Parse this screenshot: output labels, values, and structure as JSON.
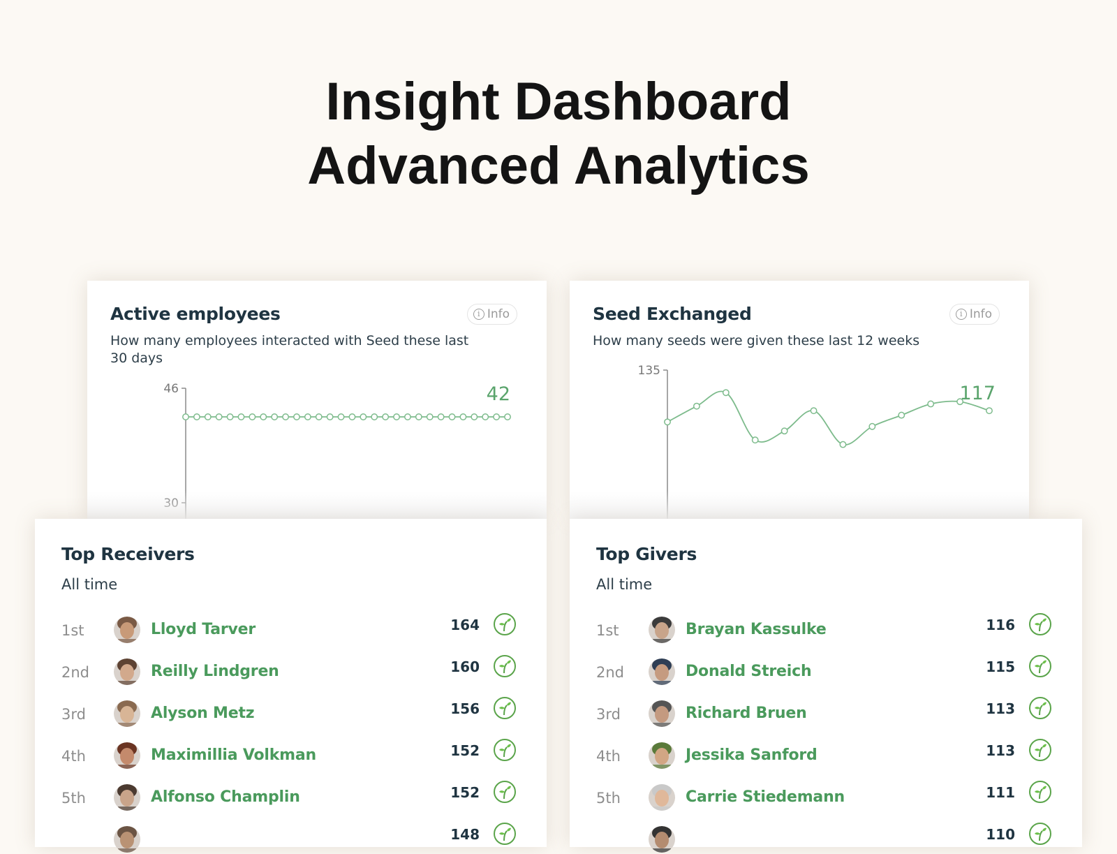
{
  "page": {
    "title_line1": "Insight Dashboard",
    "title_line2": "Advanced Analytics"
  },
  "colors": {
    "accent_green": "#4a9a5c",
    "line_green": "#7dbb8c",
    "title_dark": "#1f3441",
    "background": "#fcf9f4"
  },
  "cards": {
    "active_employees": {
      "title": "Active employees",
      "subtitle_line1": "How many employees interacted with Seed these last",
      "subtitle_line2": "30 days",
      "info_label": "Info",
      "info_icon": "info-circle-icon"
    },
    "seed_exchanged": {
      "title": "Seed Exchanged",
      "subtitle": "How many seeds were given these last 12 weeks",
      "info_label": "Info",
      "info_icon": "info-circle-icon"
    },
    "top_receivers": {
      "title": "Top Receivers",
      "subtitle": "All time",
      "rows": [
        {
          "rank": "1st",
          "name": "Lloyd Tarver",
          "count": "164"
        },
        {
          "rank": "2nd",
          "name": "Reilly Lindgren",
          "count": "160"
        },
        {
          "rank": "3rd",
          "name": "Alyson Metz",
          "count": "156"
        },
        {
          "rank": "4th",
          "name": "Maximillia Volkman",
          "count": "152"
        },
        {
          "rank": "5th",
          "name": "Alfonso Champlin",
          "count": "152"
        },
        {
          "rank": "",
          "name": "",
          "count": "148"
        }
      ],
      "row_icon": "seed-sprout-icon"
    },
    "top_givers": {
      "title": "Top Givers",
      "subtitle": "All time",
      "rows": [
        {
          "rank": "1st",
          "name": "Brayan Kassulke",
          "count": "116"
        },
        {
          "rank": "2nd",
          "name": "Donald Streich",
          "count": "115"
        },
        {
          "rank": "3rd",
          "name": "Richard Bruen",
          "count": "113"
        },
        {
          "rank": "4th",
          "name": "Jessika Sanford",
          "count": "113"
        },
        {
          "rank": "5th",
          "name": "Carrie Stiedemann",
          "count": "111"
        },
        {
          "rank": "",
          "name": "",
          "count": "110"
        }
      ],
      "row_icon": "seed-sprout-icon"
    }
  },
  "chart_data": [
    {
      "type": "line",
      "title": "Active employees",
      "subtitle": "How many employees interacted with Seed these last 30 days",
      "xlabel": "",
      "ylabel": "",
      "x": [
        1,
        2,
        3,
        4,
        5,
        6,
        7,
        8,
        9,
        10,
        11,
        12,
        13,
        14,
        15,
        16,
        17,
        18,
        19,
        20,
        21,
        22,
        23,
        24,
        25,
        26,
        27,
        28,
        29,
        30
      ],
      "values": [
        42,
        42,
        42,
        42,
        42,
        42,
        42,
        42,
        42,
        42,
        42,
        42,
        42,
        42,
        42,
        42,
        42,
        42,
        42,
        42,
        42,
        42,
        42,
        42,
        42,
        42,
        42,
        42,
        42,
        42
      ],
      "yticks": [
        "46",
        "30"
      ],
      "ylim": [
        30,
        46
      ],
      "last_value_label": "42",
      "grid": false,
      "legend": "none"
    },
    {
      "type": "line",
      "title": "Seed Exchanged",
      "subtitle": "How many seeds were given these last 12 weeks",
      "xlabel": "",
      "ylabel": "",
      "x": [
        1,
        2,
        3,
        4,
        5,
        6,
        7,
        8,
        9,
        10,
        11,
        12
      ],
      "values": [
        112,
        119,
        125,
        104,
        108,
        117,
        102,
        110,
        115,
        120,
        121,
        117
      ],
      "yticks": [
        "135"
      ],
      "ylim": [
        80,
        135
      ],
      "last_value_label": "117",
      "grid": false,
      "legend": "none"
    }
  ]
}
